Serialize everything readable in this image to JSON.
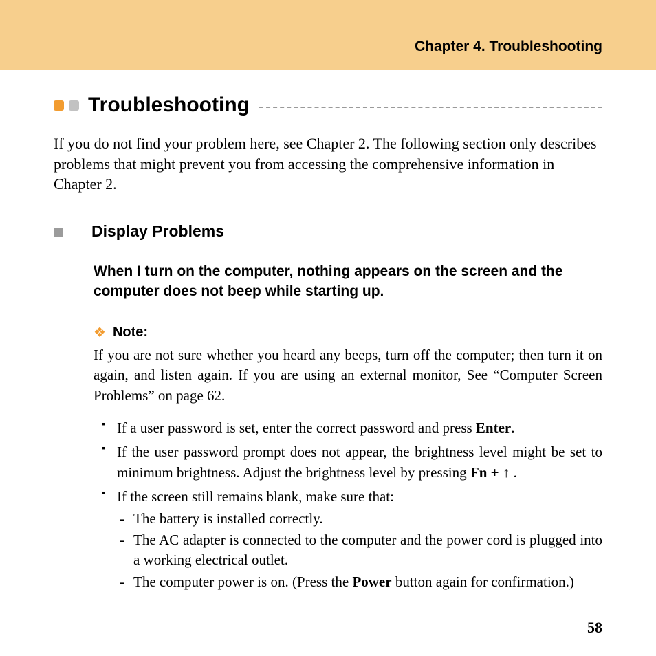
{
  "header": {
    "chapter": "Chapter 4. Troubleshooting"
  },
  "section": {
    "title": "Troubleshooting",
    "intro": "If you do not find your problem here, see Chapter 2. The following section only describes problems that might prevent you from accessing the comprehensive information in Chapter 2."
  },
  "subsection": {
    "title": "Display Problems",
    "problem_title": "When I turn on the computer, nothing appears on the screen and the computer does not beep while starting up.",
    "note": {
      "label": "Note:",
      "text": "If you are not sure whether you heard any beeps, turn off the computer; then turn it on again, and listen again. If you are using an external monitor, See “Computer Screen Problems” on page 62."
    },
    "bullets": {
      "b1_pre": "If a user password is set, enter the correct password and press ",
      "b1_bold": "Enter",
      "b1_post": ".",
      "b2_pre": "If the user password prompt does not appear, the brightness level might be set to minimum brightness. Adjust the brightness level by pressing ",
      "b2_bold": "Fn + ",
      "b2_arrow": "↑",
      "b2_post": " .",
      "b3": "If the screen still remains blank, make sure that:",
      "b3_sub1": "The battery is installed correctly.",
      "b3_sub2": "The AC adapter is connected to the computer and the power cord is plugged into a working electrical outlet.",
      "b3_sub3_pre": "The computer power is on. (Press the ",
      "b3_sub3_bold": "Power",
      "b3_sub3_post": " button again for confirmation.)"
    }
  },
  "page_number": "58"
}
